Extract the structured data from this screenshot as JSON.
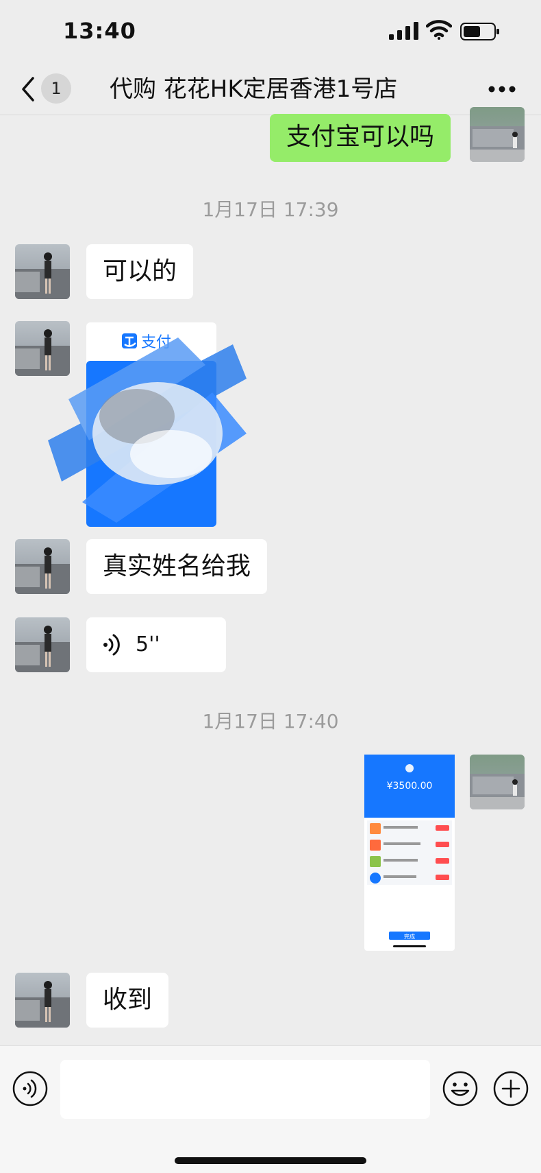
{
  "status_bar": {
    "time": "13:40"
  },
  "header": {
    "unread_count": "1",
    "title": "代购 花花HK定居香港1号店"
  },
  "messages": {
    "m1": {
      "text": "支付宝可以吗"
    },
    "ts1": "1月17日 17:39",
    "m2": {
      "text": "可以的"
    },
    "m3": {
      "app_label": "支付"
    },
    "m4": {
      "text": "真实姓名给我"
    },
    "m5": {
      "duration": "5''"
    },
    "ts2": "1月17日 17:40",
    "m6": {
      "amount": "¥3500.00",
      "button_label": "完成"
    },
    "m7": {
      "text": "收到"
    }
  },
  "colors": {
    "outgoing_bubble": "#95ec69",
    "incoming_bubble": "#ffffff",
    "alipay_blue": "#1677ff"
  }
}
